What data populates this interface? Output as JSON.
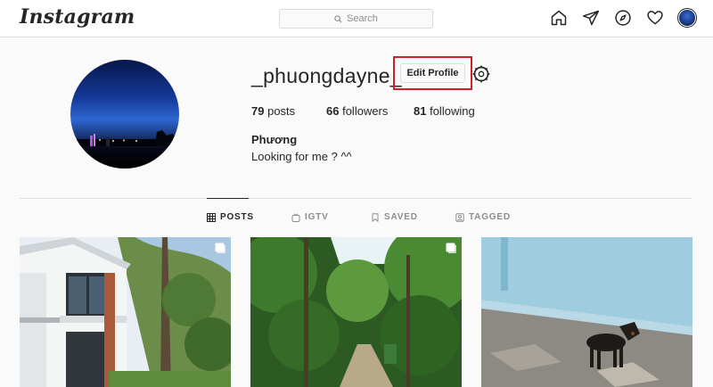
{
  "header": {
    "logo": "Instagram",
    "search_placeholder": "Search",
    "icons": [
      "home-icon",
      "direct-icon",
      "explore-icon",
      "activity-icon",
      "profile-avatar"
    ]
  },
  "profile": {
    "username": "_phuongdayne_",
    "edit_button": "Edit Profile",
    "stats": {
      "posts_count": "79",
      "posts_label": "posts",
      "followers_count": "66",
      "followers_label": "followers",
      "following_count": "81",
      "following_label": "following"
    },
    "full_name": "Phương",
    "bio": "Looking for me ? ^^"
  },
  "tabs": [
    {
      "label": "POSTS",
      "icon": "grid-icon",
      "active": true
    },
    {
      "label": "IGTV",
      "icon": "igtv-icon",
      "active": false
    },
    {
      "label": "SAVED",
      "icon": "bookmark-icon",
      "active": false
    },
    {
      "label": "TAGGED",
      "icon": "tagged-icon",
      "active": false
    }
  ],
  "posts": [
    {
      "subject": "white villa with trees",
      "multiple": true
    },
    {
      "subject": "green forest path",
      "multiple": true
    },
    {
      "subject": "black dog by blue wall",
      "multiple": false
    }
  ],
  "colors": {
    "highlight_border": "#d0202a",
    "text": "#262626",
    "muted": "#8e8e8e",
    "border": "#dbdbdb"
  }
}
